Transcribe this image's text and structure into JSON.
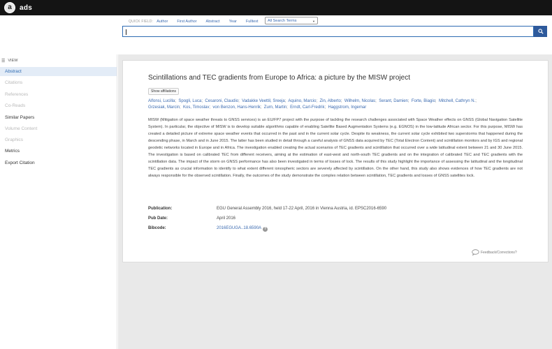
{
  "header": {
    "logo_letter": "a",
    "logo_text": "ads"
  },
  "quick_fields": {
    "label": "QUICK FIELD:",
    "fields": [
      "Author",
      "First Author",
      "Abstract",
      "Year",
      "Fulltext"
    ],
    "select_value": "All Search Terms"
  },
  "search": {
    "value": ""
  },
  "sidebar": {
    "view_label": "VIEW",
    "items": [
      {
        "label": "Abstract",
        "state": "active"
      },
      {
        "label": "Citations",
        "state": "disabled"
      },
      {
        "label": "References",
        "state": "disabled"
      },
      {
        "label": "Co-Reads",
        "state": "disabled"
      },
      {
        "label": "Similar Papers",
        "state": "normal"
      },
      {
        "label": "Volume Content",
        "state": "disabled"
      },
      {
        "label": "Graphics",
        "state": "disabled"
      },
      {
        "label": "Metrics",
        "state": "normal"
      },
      {
        "label": "Export Citation",
        "state": "normal"
      }
    ]
  },
  "paper": {
    "title": "Scintillations and TEC gradients from Europe to Africa: a picture by the MISW project",
    "show_affiliations": "Show affiliations",
    "authors": [
      "Alfonsi, Lucilla",
      "Spogli, Luca",
      "Cesaroni, Claudio",
      "Vadakke Veettil, Sreeja",
      "Aquino, Marcio",
      "Zin, Alberto",
      "Wilhelm, Nicolas",
      "Serant, Damien",
      "Forte, Biagio",
      "Mitchell, Cathryn N.",
      "Grzesiak, Marcin",
      "Kos, Timoslav",
      "von Benzon, Hans-Henrik",
      "Zurn, Martin",
      "Erndt, Carl-Fredrik",
      "Haggstrom, Ingemar"
    ],
    "abstract": "MISW (Mitigation of space weather threats to GNSS services) is an EU/FP7 project with the purpose of tackling the research challenges associated with Space Weather effects on GNSS (Global Navigation Satellite System). In particular, the objective of MISW is to develop suitable algorithms capable of enabling Satellite Based Augmentation Systems (e.g. EGNOS) in the low-latitude African sector. For this purpose, MISW has created a detailed picture of extreme space weather events that occurred in the past and in the current solar cycle. Despite its weakness, the current solar cycle exhibited two superstorms that happened during the descending phase, in March and in June 2015. The latter has been studied in detail through a careful analysis of GNSS data acquired by TEC (Total Electron Content) and scintillation monitors and by IGS and regional geodetic networks located in Europe and in Africa. The investigation enabled creating the actual scenarios of TEC gradients and scintillation that occurred over a wide latitudinal extent between 21 and 30 June 2015. The investigation is based on calibrated TEC from different receivers, aiming at the estimation of east-west and north-south TEC gradients and on the integration of calibrated TEC and TEC gradients with the scintillation data. The impact of the storm on GNSS performance has also been investigated in terms of losses of lock. The results of this study highlight the importance of assessing the latitudinal and the longitudinal TEC gradients as crucial information to identify to what extent different ionospheric sectors are severely affected by scintillation. On the other hand, this study also shows evidences of how TEC gradients are not always responsible for the observed scintillation. Finally, the outcomes of the study demonstrate the complex relation between scintillation, TEC gradients and losses of GNSS satellites lock.",
    "publication_label": "Publication:",
    "publication_value": "EGU General Assembly 2016, held 17-22 April, 2016 in Vienna Austria, id. EPSC2016-6590",
    "pubdate_label": "Pub Date:",
    "pubdate_value": "April 2016",
    "bibcode_label": "Bibcode:",
    "bibcode_value": "2016EGUGA..18.6590A",
    "feedback": "Feedback/Corrections?"
  },
  "colors": {
    "topbar": "#141414",
    "link": "#3a6ab0",
    "search_button": "#2e5a9c",
    "active_nav_bg": "#e3ecf7"
  }
}
